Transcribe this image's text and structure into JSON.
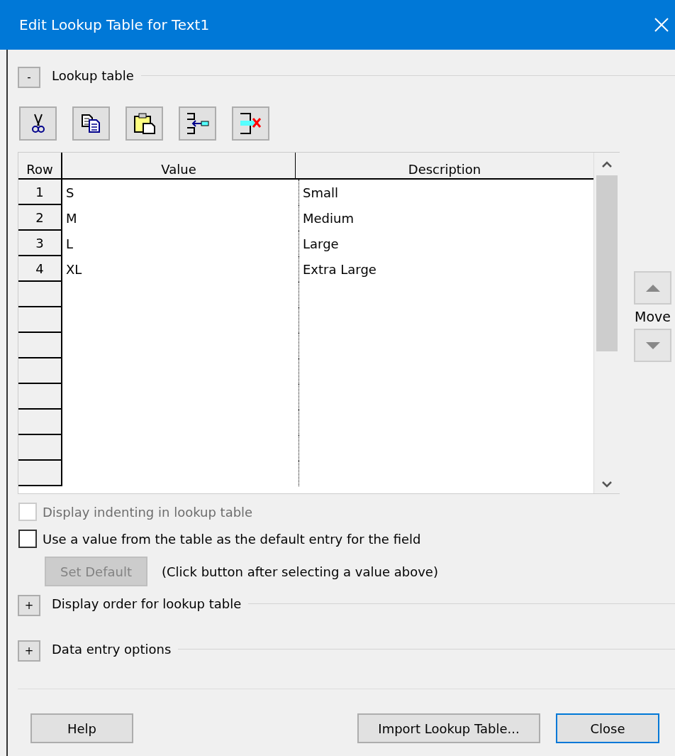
{
  "window": {
    "title": "Edit Lookup Table for Text1"
  },
  "sections": [
    {
      "toggle": "-",
      "label": "Lookup table"
    },
    {
      "toggle": "+",
      "label": "Display order for lookup table"
    },
    {
      "toggle": "+",
      "label": "Data entry options"
    }
  ],
  "toolbar": [
    {
      "kind": "cut"
    },
    {
      "kind": "copy"
    },
    {
      "kind": "paste"
    },
    {
      "kind": "insert"
    },
    {
      "kind": "delete"
    }
  ],
  "table": {
    "columns": [
      "Row",
      "Value",
      "Description"
    ],
    "rows": [
      {
        "row": "1",
        "value": "S",
        "description": "Small"
      },
      {
        "row": "2",
        "value": "M",
        "description": "Medium"
      },
      {
        "row": "3",
        "value": "L",
        "description": "Large"
      },
      {
        "row": "4",
        "value": "XL",
        "description": "Extra Large"
      }
    ]
  },
  "move": {
    "label": "Move",
    "up_disabled": true,
    "down_disabled": true
  },
  "checkboxes": [
    {
      "label": "Display indenting in lookup table",
      "checked": false,
      "disabled": true
    },
    {
      "label": "Use a value from the table as the default entry for the field",
      "checked": false,
      "disabled": false
    }
  ],
  "set_default": {
    "label": "Set Default",
    "disabled": true,
    "hint": "(Click button after selecting a value above)"
  },
  "buttons": [
    {
      "label": "Help",
      "focused": false
    },
    {
      "label": "Import Lookup Table...",
      "focused": false
    },
    {
      "label": "Close",
      "focused": true
    }
  ]
}
